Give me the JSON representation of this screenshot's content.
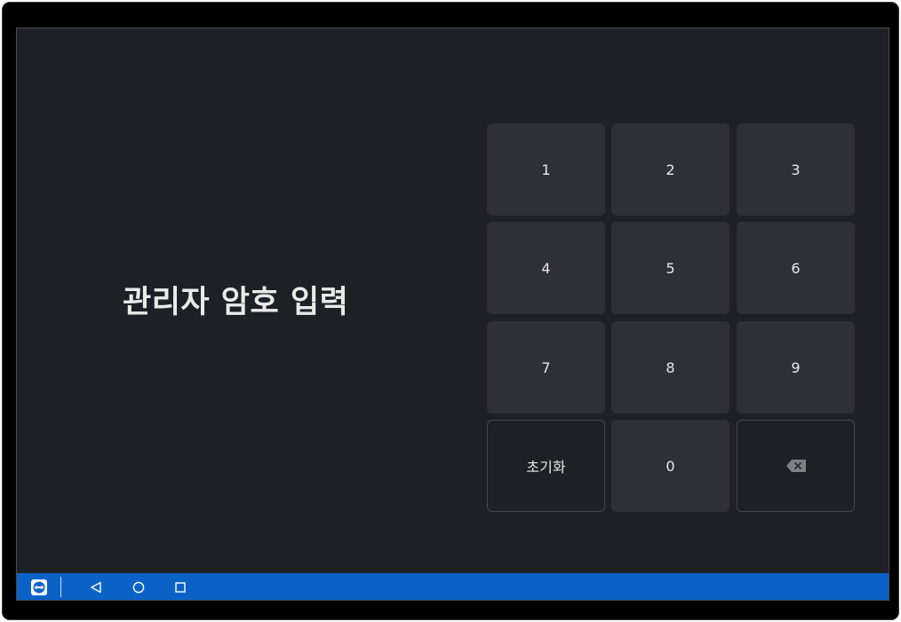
{
  "title": "관리자 암호 입력",
  "keypad": {
    "keys": [
      "1",
      "2",
      "3",
      "4",
      "5",
      "6",
      "7",
      "8",
      "9"
    ],
    "reset_label": "초기화",
    "zero_label": "0",
    "backspace_icon": "backspace-icon"
  },
  "navbar": {
    "app_icon": "teamviewer-icon",
    "back_icon": "back-triangle-icon",
    "home_icon": "home-circle-icon",
    "recents_icon": "recents-square-icon",
    "color": "#0a62c7"
  },
  "colors": {
    "background": "#1f2025",
    "key": "#2e3039",
    "key_outline": "#45464c",
    "text": "#e8e8e8"
  }
}
